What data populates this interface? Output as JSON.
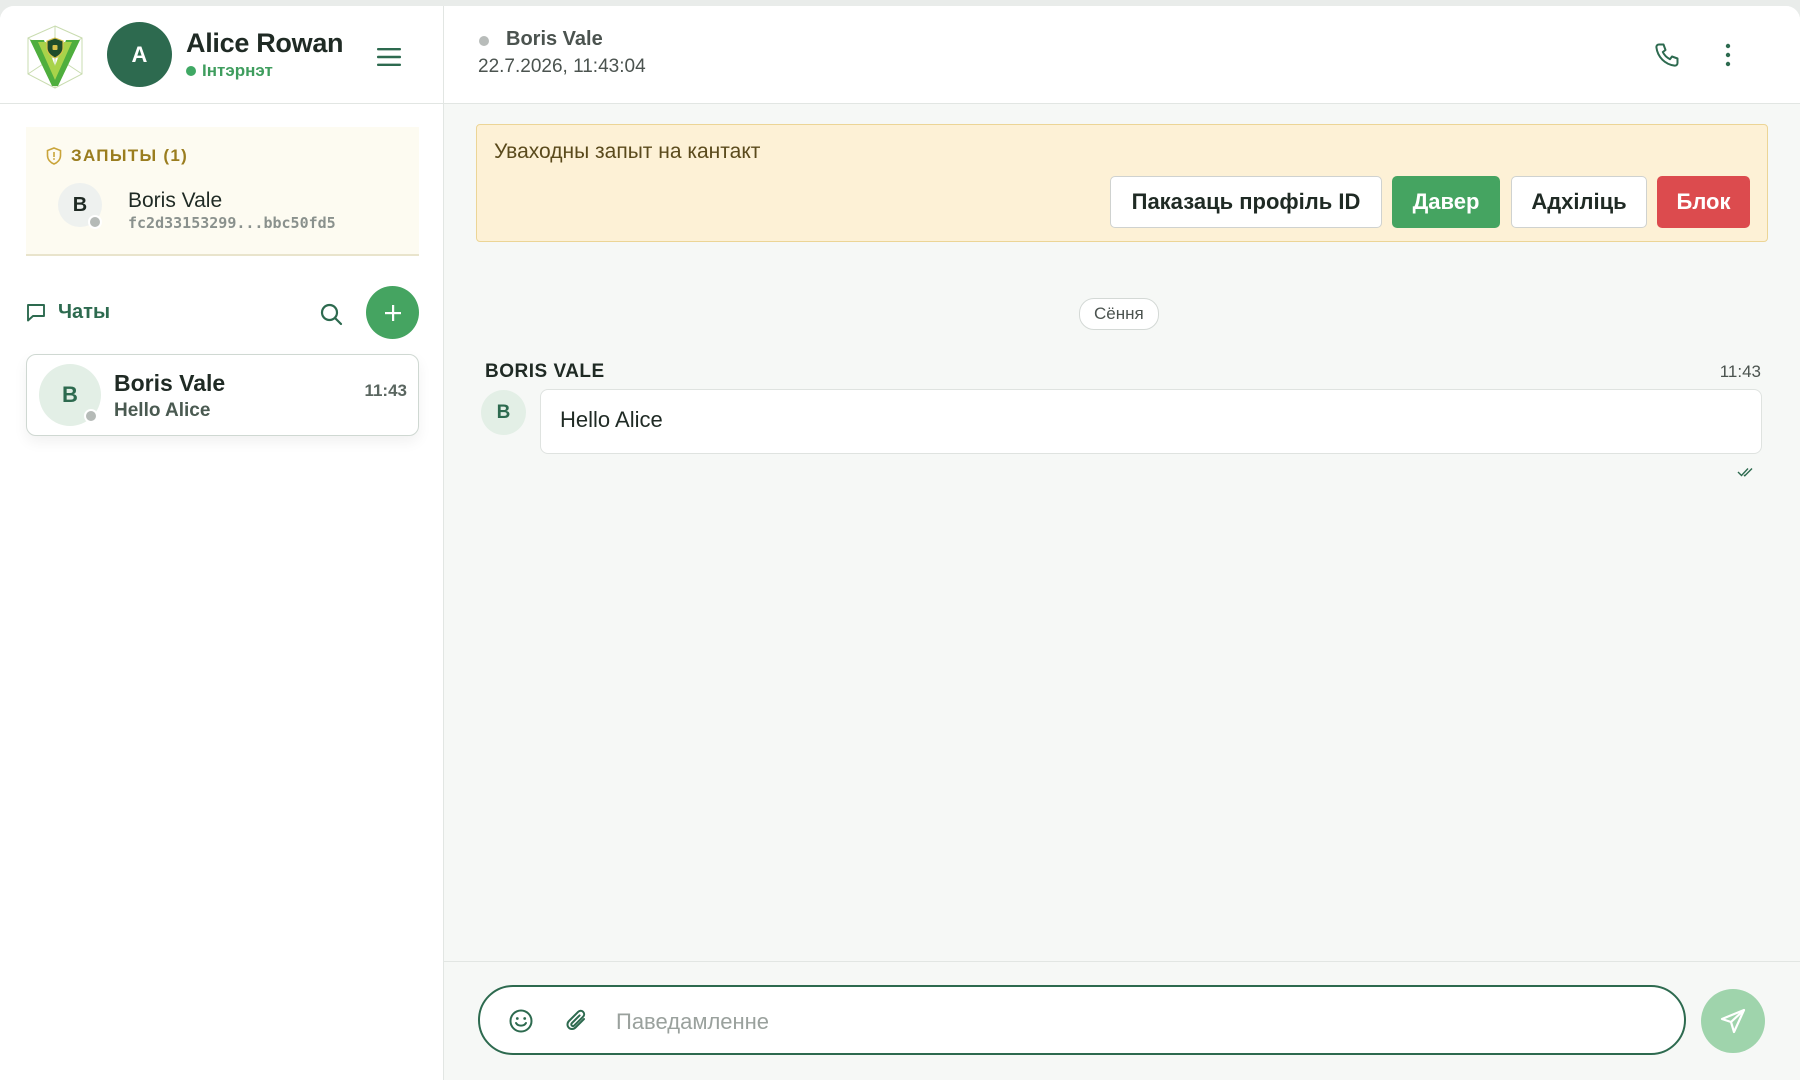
{
  "colors": {
    "brand": "#2d6a4f",
    "accent": "#45a461",
    "danger": "#dc4b4e",
    "warning_bg": "#fdf1d6",
    "request_label": "#9a7d1f"
  },
  "me": {
    "avatar_letter": "A",
    "name": "Alice Rowan",
    "status": "Інтэрнэт"
  },
  "requests": {
    "title": "ЗАПЫТЫ (1)",
    "items": [
      {
        "avatar_letter": "B",
        "name": "Boris Vale",
        "id": "fc2d33153299...bbc50fd5"
      }
    ]
  },
  "chats": {
    "title": "Чаты",
    "items": [
      {
        "avatar_letter": "B",
        "name": "Boris Vale",
        "preview": "Hello Alice",
        "time": "11:43"
      }
    ]
  },
  "conversation": {
    "peer_name": "Boris Vale",
    "peer_subtitle": "22.7.2026, 11:43:04",
    "banner": {
      "text": "Уваходны запыт на кантакт",
      "show_profile_label": "Паказаць профіль ID",
      "trust_label": "Давер",
      "reject_label": "Адхіліць",
      "block_label": "Блок"
    },
    "day_separator": "Сёння",
    "messages": [
      {
        "sender": "BORIS VALE",
        "avatar_letter": "B",
        "time": "11:43",
        "text": "Hello Alice"
      }
    ],
    "composer": {
      "placeholder": "Паведамленне",
      "value": ""
    }
  },
  "icons": {
    "logo": "shield-v-logo",
    "menu": "hamburger-icon",
    "requests": "shield-icon",
    "chats": "chat-bubble-icon",
    "search": "search-icon",
    "add": "plus-icon",
    "call": "phone-icon",
    "more": "kebab-icon",
    "emoji": "smiley-icon",
    "attach": "paperclip-icon",
    "send": "send-icon",
    "read": "double-check-icon"
  }
}
